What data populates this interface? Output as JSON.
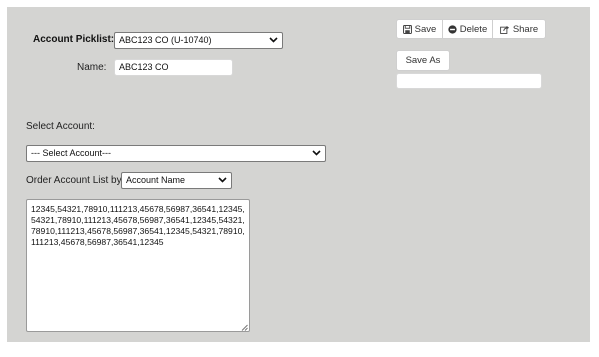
{
  "form": {
    "picklist_label": "Account Picklist:",
    "picklist_value": "ABC123 CO  (U-10740)",
    "name_label": "Name:",
    "name_value": "ABC123 CO",
    "select_account_label": "Select Account:",
    "select_account_value": "--- Select Account---",
    "order_label": "Order Account List by:",
    "order_value": "Account Name",
    "account_list_text": "12345,54321,78910,111213,45678,56987,36541,12345,54321,78910,111213,45678,56987,36541,12345,54321,78910,111213,45678,56987,36541,12345,54321,78910,111213,45678,56987,36541,12345"
  },
  "toolbar": {
    "save_label": "Save",
    "delete_label": "Delete",
    "share_label": "Share",
    "save_as_label": "Save As",
    "save_as_input_value": ""
  },
  "icons": {
    "save": "floppy-disk-icon",
    "delete": "minus-circle-icon",
    "share": "share-arrow-icon",
    "dropdown": "chevron-down-icon"
  },
  "colors": {
    "panel_background": "#d4d4d2",
    "page_background": "#ffffff"
  }
}
